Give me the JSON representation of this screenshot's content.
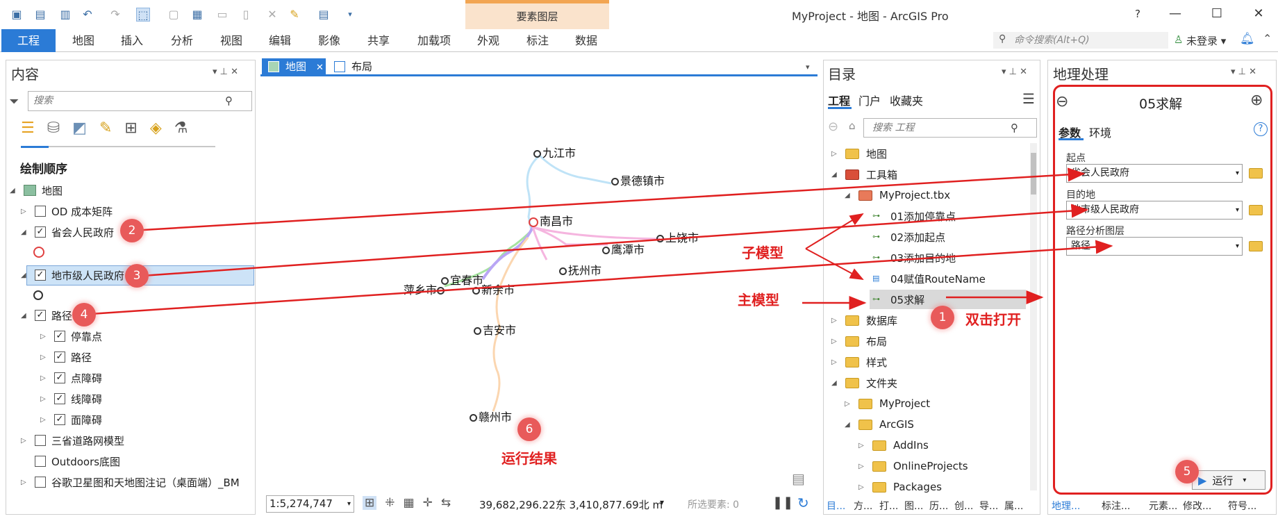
{
  "app": {
    "title": "MyProject - 地图 - ArcGIS Pro",
    "context_header": "要素图层",
    "help": "?",
    "login": "未登录 ▾"
  },
  "ribbon": {
    "tabs": [
      "工程",
      "地图",
      "插入",
      "分析",
      "视图",
      "编辑",
      "影像",
      "共享",
      "加载项"
    ],
    "context_tabs": [
      "外观",
      "标注",
      "数据"
    ],
    "command_search_placeholder": "命令搜索(Alt+Q)"
  },
  "contents": {
    "title": "内容",
    "search_placeholder": "搜索",
    "section": "绘制顺序",
    "layers": [
      {
        "label": "地图"
      },
      {
        "label": "OD 成本矩阵",
        "checked": false
      },
      {
        "label": "省会人民政府",
        "checked": true
      },
      {
        "label": "地市级人民政府",
        "checked": true
      },
      {
        "label": "路径",
        "checked": true
      },
      {
        "label": "停靠点",
        "checked": true
      },
      {
        "label": "路径",
        "checked": true
      },
      {
        "label": "点障碍",
        "checked": true
      },
      {
        "label": "线障碍",
        "checked": true
      },
      {
        "label": "面障碍",
        "checked": true
      },
      {
        "label": "三省道路网模型",
        "checked": false
      },
      {
        "label": "Outdoors底图",
        "checked": false
      },
      {
        "label": "谷歌卫星图和天地图注记（桌面端）_BM",
        "checked": false
      }
    ]
  },
  "map": {
    "tab_map": "地图",
    "tab_layout": "布局",
    "cities": [
      "九江市",
      "景德镇市",
      "南昌市",
      "上饶市",
      "鹰潭市",
      "抚州市",
      "宜春市",
      "萍乡市",
      "新余市",
      "吉安市",
      "赣州市"
    ],
    "scale": "1:5,274,747",
    "coords": "39,682,296.22东 3,410,877.69北 m",
    "selected": "所选要素: 0"
  },
  "catalog": {
    "title": "目录",
    "tabs": [
      "工程",
      "门户",
      "收藏夹"
    ],
    "search_placeholder": "搜索 工程",
    "items": [
      {
        "label": "地图"
      },
      {
        "label": "工具箱"
      },
      {
        "label": "MyProject.tbx"
      },
      {
        "label": "01添加停靠点"
      },
      {
        "label": "02添加起点"
      },
      {
        "label": "03添加目的地"
      },
      {
        "label": "04赋值RouteName"
      },
      {
        "label": "05求解"
      },
      {
        "label": "数据库"
      },
      {
        "label": "布局"
      },
      {
        "label": "样式"
      },
      {
        "label": "文件夹"
      },
      {
        "label": "MyProject"
      },
      {
        "label": "ArcGIS"
      },
      {
        "label": "AddIns"
      },
      {
        "label": "OnlineProjects"
      },
      {
        "label": "Packages"
      }
    ]
  },
  "geoprocessing": {
    "title": "地理处理",
    "tool_title": "05求解",
    "tabs": [
      "参数",
      "环境"
    ],
    "params": [
      {
        "label": "起点",
        "value": "省会人民政府"
      },
      {
        "label": "目的地",
        "value": "地市级人民政府"
      },
      {
        "label": "路径分析图层",
        "value": "路径"
      }
    ],
    "run_label": "运行"
  },
  "bottom_tabs_left": [
    "目...",
    "方...",
    "打...",
    "图...",
    "历...",
    "创...",
    "导...",
    "属..."
  ],
  "bottom_tabs_right": [
    "地理...",
    "标注...",
    "元素...",
    "修改...",
    "符号..."
  ],
  "annotations": {
    "badges": [
      "1",
      "2",
      "3",
      "4",
      "5",
      "6"
    ],
    "sub_model": "子模型",
    "main_model": "主模型",
    "double_click": "双击打开",
    "run_result": "运行结果"
  }
}
